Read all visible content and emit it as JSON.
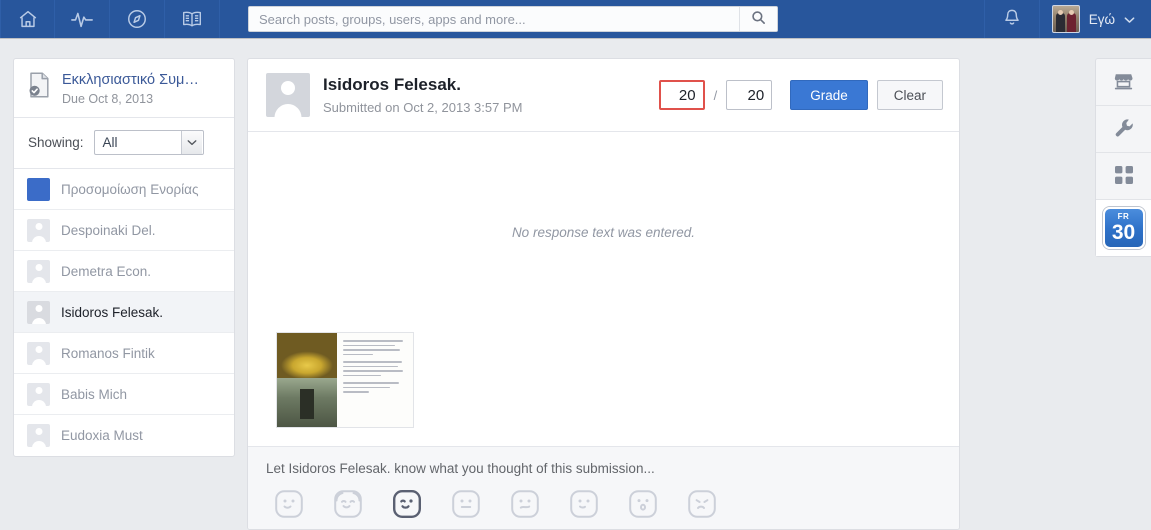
{
  "topnav": {
    "icons": [
      {
        "name": "home-icon",
        "label": "Home"
      },
      {
        "name": "activity-pulse-icon",
        "label": "Activity"
      },
      {
        "name": "compass-icon",
        "label": "Explore"
      },
      {
        "name": "open-book-icon",
        "label": "Resources"
      }
    ],
    "search": {
      "placeholder": "Search posts, groups, users, apps and more...",
      "value": "",
      "button_icon": "search-icon"
    },
    "bell_icon": "notification-bell-icon",
    "account": {
      "label": "Εγώ",
      "avatar_icon": "user-avatar-photo",
      "caret_icon": "chevron-down-icon"
    },
    "bar_color": "#28569c"
  },
  "sidebar": {
    "assignment": {
      "icon": "assignment-document-icon",
      "title": "Εκκλησιαστικό Συμ…",
      "due": "Due Oct 8, 2013"
    },
    "showing": {
      "label": "Showing:",
      "value": "All",
      "caret_icon": "chevron-down-icon"
    },
    "students": [
      {
        "name": "Προσομοίωση Ενορίας",
        "type": "group",
        "selected": false
      },
      {
        "name": "Despoinaki Del.",
        "type": "person",
        "selected": false
      },
      {
        "name": "Demetra Econ.",
        "type": "person",
        "selected": false
      },
      {
        "name": "Isidoros Felesak.",
        "type": "person",
        "selected": true
      },
      {
        "name": "Romanos Fintik",
        "type": "person",
        "selected": false
      },
      {
        "name": "Babis Mich",
        "type": "person",
        "selected": false
      },
      {
        "name": "Eudoxia Must",
        "type": "person",
        "selected": false
      }
    ],
    "group_avatar_color": "#3b6cc8"
  },
  "main": {
    "submission": {
      "avatar_icon": "user-avatar-placeholder-icon",
      "student_name": "Isidoros Felesak.",
      "submitted_meta": "Submitted on Oct 2, 2013 3:57 PM"
    },
    "grading": {
      "score_value": "20",
      "score_invalid_color": "#e0514b",
      "separator": "/",
      "max_value": "20",
      "grade_label": "Grade",
      "clear_label": "Clear",
      "grade_button_color": "#3a78d4"
    },
    "response": {
      "empty_text": "No response text was entered."
    },
    "attachment": {
      "name": "submission-thumbnail",
      "description": "Scanned handwritten page with two church photographs"
    },
    "comment": {
      "placeholder": "Let Isidoros Felesak. know what you thought of this submission...",
      "emojis": [
        {
          "name": "emoji-smile",
          "selected": false
        },
        {
          "name": "emoji-happy-hug",
          "selected": false
        },
        {
          "name": "emoji-wink",
          "selected": true
        },
        {
          "name": "emoji-neutral",
          "selected": false
        },
        {
          "name": "emoji-unsure",
          "selected": false
        },
        {
          "name": "emoji-slight-smile",
          "selected": false
        },
        {
          "name": "emoji-surprised",
          "selected": false
        },
        {
          "name": "emoji-sad",
          "selected": false
        }
      ]
    }
  },
  "right_rail": {
    "items": [
      {
        "name": "store-icon",
        "label": "Store"
      },
      {
        "name": "wrench-icon",
        "label": "Tools"
      },
      {
        "name": "grid-apps-icon",
        "label": "Apps"
      }
    ],
    "calendar": {
      "name": "calendar-icon",
      "day_of_week": "FR",
      "day": "30",
      "color": "#2f72c9"
    }
  }
}
